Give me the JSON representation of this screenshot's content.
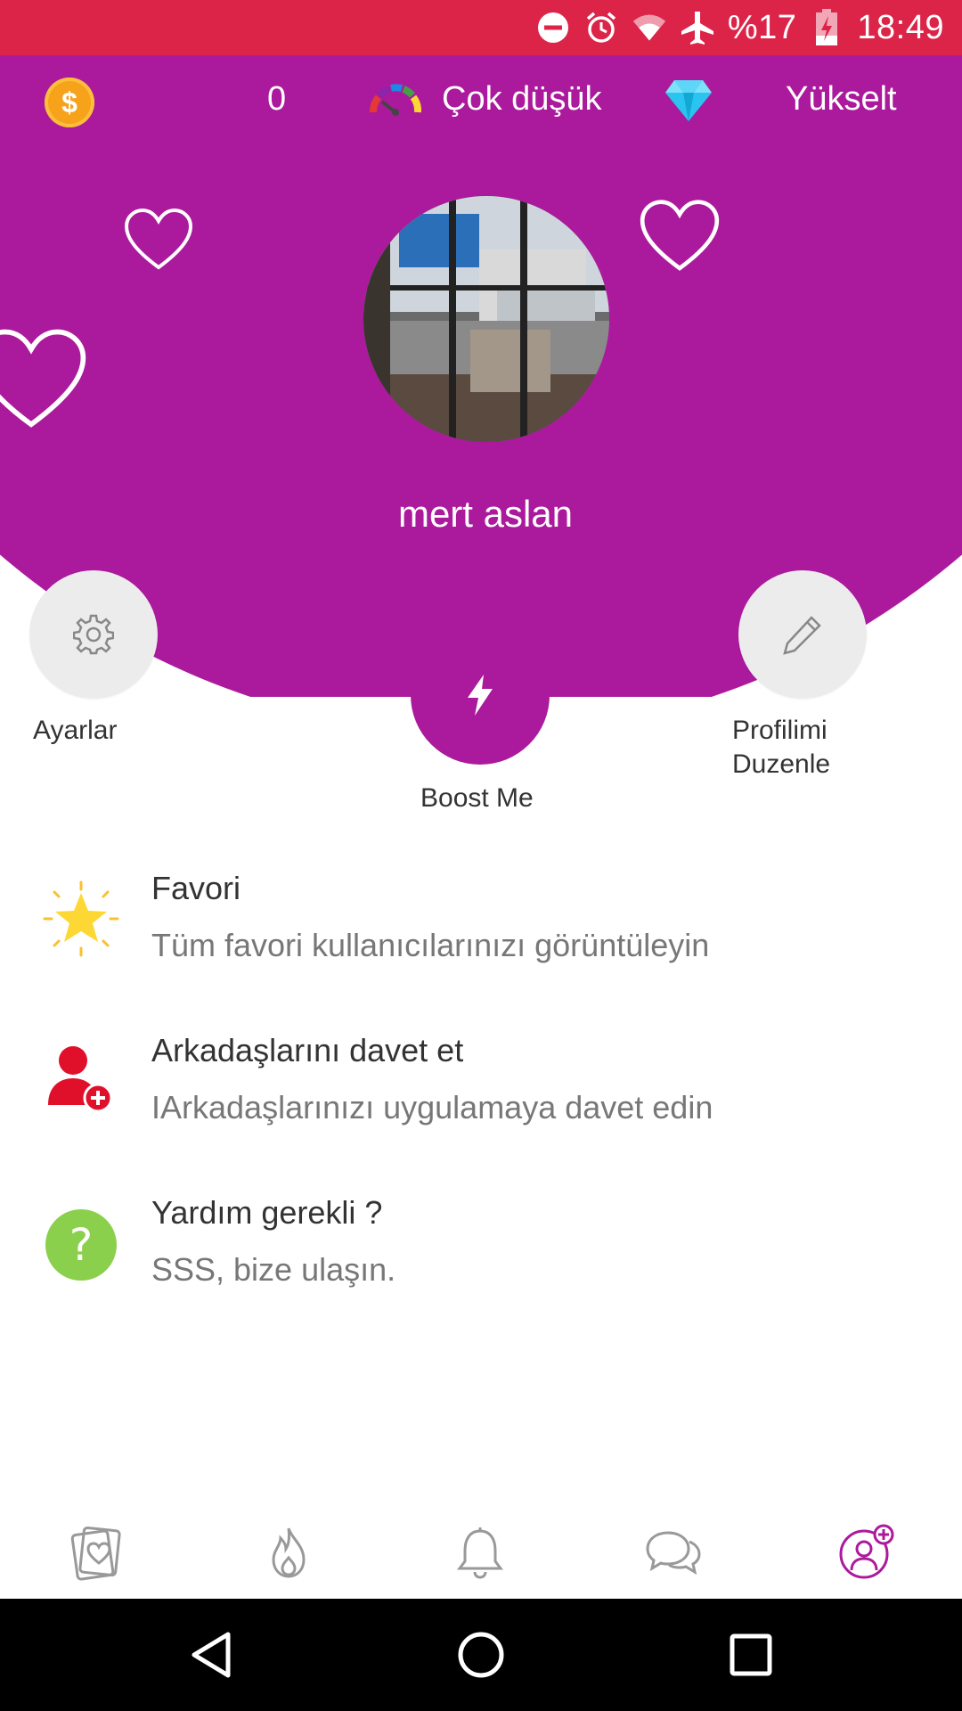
{
  "status_bar": {
    "battery_text": "%17",
    "time": "18:49",
    "background_color": "#dc2449",
    "icons": [
      "do-not-disturb-icon",
      "alarm-icon",
      "wifi-icon",
      "airplane-icon",
      "battery-charging-icon"
    ]
  },
  "header": {
    "background_color": "#ab1a9c",
    "coin_icon": "coin-icon",
    "coin_symbol": "$",
    "coin_count": "0",
    "popularity_icon": "gauge-icon",
    "popularity_text": "Çok düşük",
    "premium_icon": "diamond-icon",
    "upgrade_label": "Yükselt",
    "username": "mert aslan"
  },
  "actions": {
    "settings_label": "Ayarlar",
    "boost_label": "Boost Me",
    "edit_profile_label_line1": "Profilimi",
    "edit_profile_label_line2": "Duzenle"
  },
  "menu": {
    "items": [
      {
        "title": "Favori",
        "subtitle": "Tüm favori kullanıcılarınızı görüntüleyin",
        "icon": "star-icon"
      },
      {
        "title": "Arkadaşlarını davet et",
        "subtitle": "IArkadaşlarınızı uygulamaya davet edin",
        "icon": "add-user-icon"
      },
      {
        "title": "Yardım gerekli ?",
        "subtitle": "SSS, bize ulaşın.",
        "icon": "help-icon"
      }
    ]
  },
  "tab_bar": {
    "tabs": [
      "cards-heart-icon",
      "flame-icon",
      "bell-icon",
      "chat-icon",
      "profile-add-icon"
    ],
    "active_tab": "profile-add-icon",
    "active_color": "#ab1a9c"
  },
  "nav_bar": {
    "buttons": [
      "back-icon",
      "home-icon",
      "recents-icon"
    ]
  }
}
